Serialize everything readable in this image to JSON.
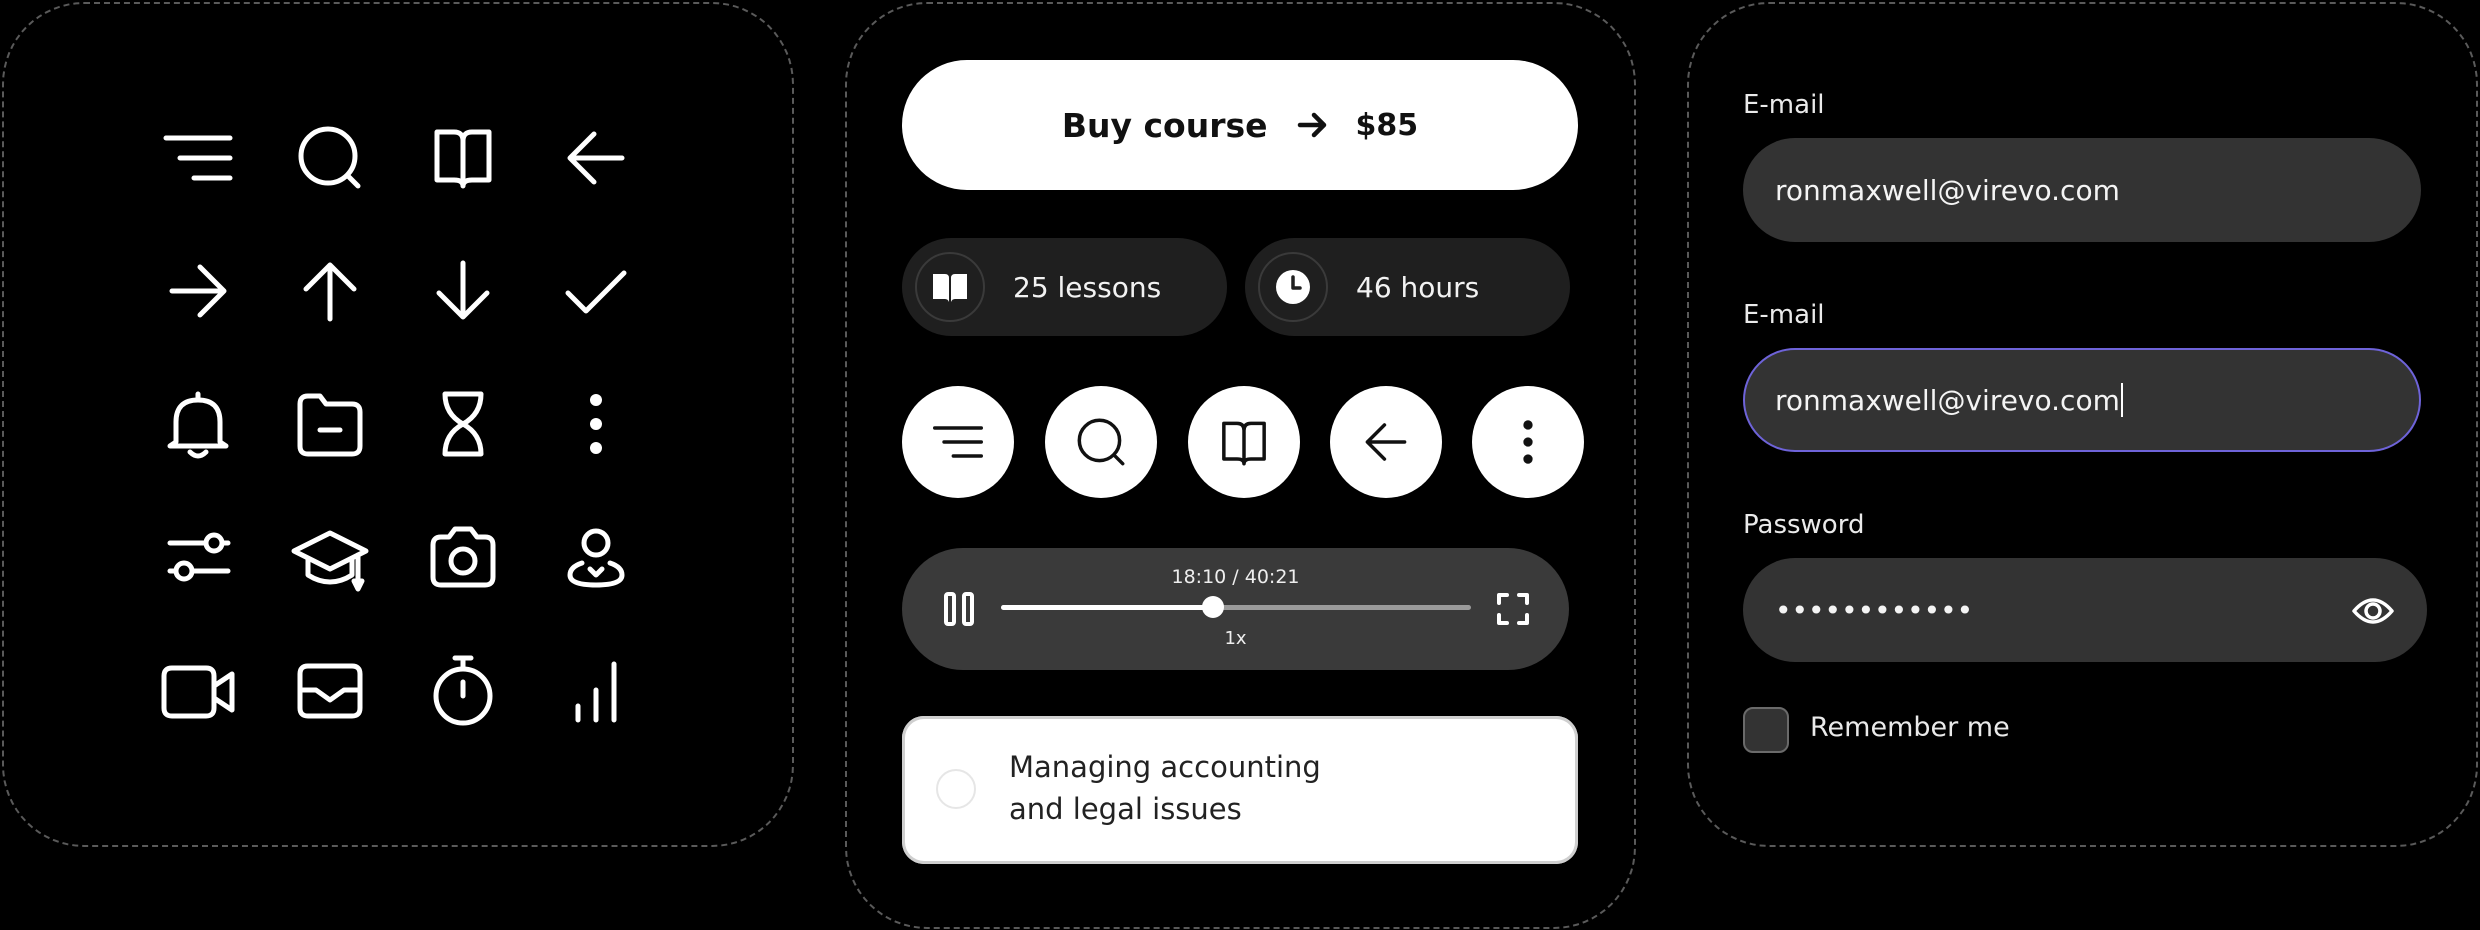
{
  "icon_grid": {
    "icons": [
      "menu-icon",
      "search-icon",
      "book-icon",
      "arrow-left-icon",
      "arrow-right-icon",
      "arrow-up-icon",
      "arrow-down-icon",
      "checkmark-icon",
      "bell-icon",
      "folder-minus-icon",
      "hourglass-icon",
      "more-vertical-icon",
      "sliders-icon",
      "graduation-cap-icon",
      "camera-icon",
      "user-location-icon",
      "video-icon",
      "mail-icon",
      "stopwatch-icon",
      "bar-chart-icon"
    ]
  },
  "course_card": {
    "buy_button": {
      "label": "Buy course",
      "price": "$85",
      "icon": "arrow-right-icon"
    },
    "stats": [
      {
        "icon": "book-icon",
        "text": "25 lessons"
      },
      {
        "icon": "clock-icon",
        "text": "46 hours"
      }
    ],
    "action_buttons": [
      "menu-icon",
      "search-icon",
      "book-icon",
      "arrow-left-icon",
      "more-vertical-icon"
    ],
    "player": {
      "time": "18:10 / 40:21",
      "speed": "1x",
      "progress": 0.45,
      "pause_icon": "pause-icon",
      "fullscreen_icon": "fullscreen-icon"
    },
    "task": {
      "line1": "Managing accounting",
      "line2": "and legal issues"
    }
  },
  "login_form": {
    "email_label_1": "E-mail",
    "email_value_1": "ronmaxwell@virevo.com",
    "email_label_2": "E-mail",
    "email_value_2": "ronmaxwell@virevo.com",
    "password_label": "Password",
    "password_value": "••••••••••••",
    "password_toggle_icon": "eye-icon",
    "remember_label": "Remember me"
  },
  "colors": {
    "background": "#000000",
    "surface": "#333333",
    "pill": "#1f1f1f",
    "focus_border": "#6e63d9",
    "button": "#ffffff"
  }
}
